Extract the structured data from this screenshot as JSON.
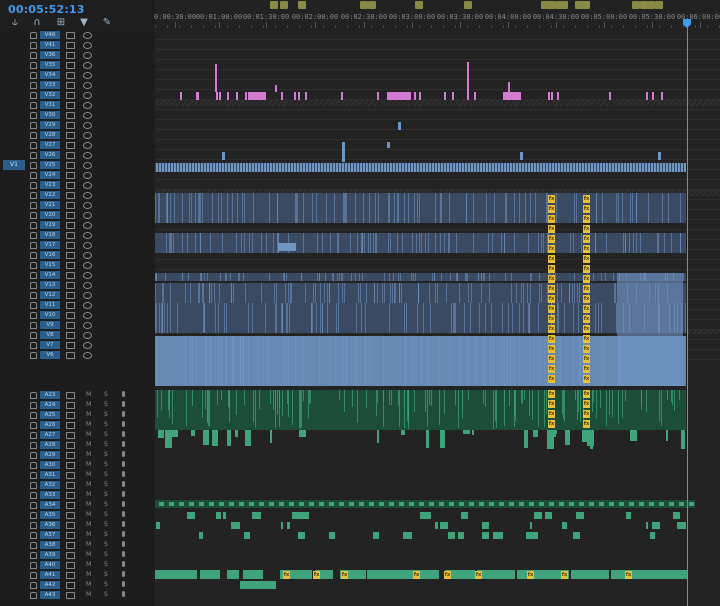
{
  "timecode": "00:05:52:13",
  "ruler": {
    "labels": [
      "0:00:30:00",
      "00:01:00:00",
      "00:01:30:00",
      "00:02:00:00",
      "00:02:30:00",
      "00:03:00:00",
      "00:03:30:00",
      "00:04:00:00",
      "00:04:30:00",
      "00:05:00:00",
      "00:05:30:00",
      "00:06:00:00"
    ]
  },
  "toolbar": {
    "icons": [
      "snap-icon",
      "linked-selection-icon",
      "add-marker-icon",
      "marker-icon",
      "wrench-icon"
    ]
  },
  "source_patch": "V1",
  "video_tracks": [
    "V46",
    "V41",
    "V36",
    "V35",
    "V34",
    "V33",
    "V32",
    "V31",
    "V30",
    "V29",
    "V28",
    "V27",
    "V26",
    "V25",
    "V24",
    "V23",
    "V22",
    "V21",
    "V20",
    "V19",
    "V18",
    "V17",
    "V16",
    "V15",
    "V14",
    "V13",
    "V12",
    "V11",
    "V10",
    "V9",
    "V8",
    "V7",
    "V6"
  ],
  "audio_tracks": [
    "A23",
    "A24",
    "A25",
    "A26",
    "A27",
    "A28",
    "A29",
    "A30",
    "A31",
    "A32",
    "A33",
    "A34",
    "A35",
    "A36",
    "A37",
    "A38",
    "A39",
    "A40",
    "A41",
    "A42",
    "A43"
  ],
  "audio_buttons": {
    "mute": "M",
    "solo": "S"
  },
  "fx_label": "fx",
  "colors": {
    "accent": "#3d9bf0",
    "video_clip": "#6f95c3",
    "audio_clip": "#3fa37b",
    "graphics_clip": "#d47ad0",
    "fx_badge": "#e8c03a"
  }
}
